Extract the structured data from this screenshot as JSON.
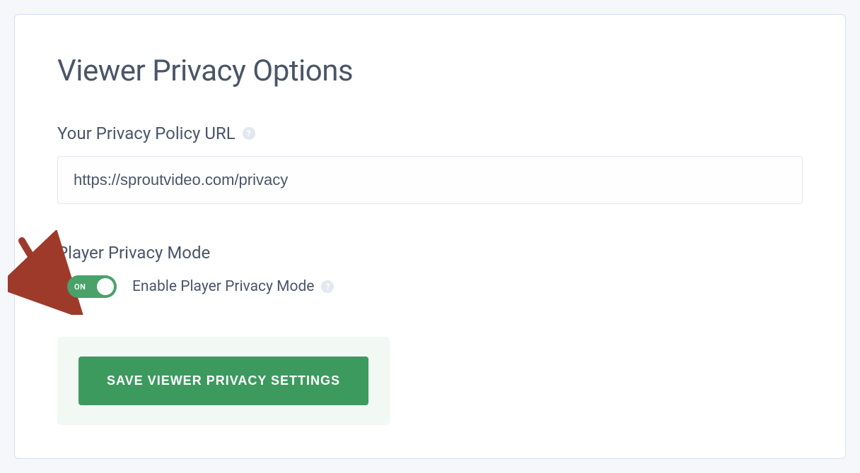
{
  "title": "Viewer Privacy Options",
  "privacy_url": {
    "label": "Your Privacy Policy URL",
    "value": "https://sproutvideo.com/privacy"
  },
  "privacy_mode": {
    "section_label": "Player Privacy Mode",
    "toggle_state": "ON",
    "description": "Enable Player Privacy Mode"
  },
  "save_button": {
    "label": "SAVE VIEWER PRIVACY SETTINGS"
  }
}
